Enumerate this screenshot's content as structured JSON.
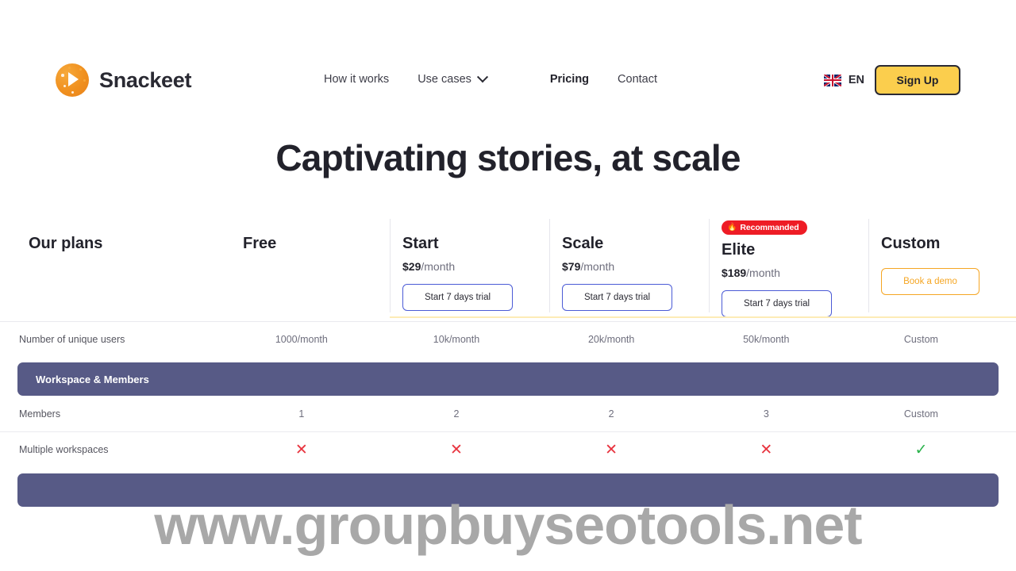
{
  "header": {
    "brand_name": "Snackeet",
    "nav": [
      {
        "label": "How it works",
        "active": false
      },
      {
        "label": "Use cases",
        "active": false,
        "has_dropdown": true
      },
      {
        "label": "Pricing",
        "active": true
      },
      {
        "label": "Contact",
        "active": false
      }
    ],
    "language": "EN",
    "signup_label": "Sign Up"
  },
  "hero": {
    "title": "Captivating stories, at scale"
  },
  "plans": {
    "label_header": "Our plans",
    "columns": [
      {
        "name": "Free",
        "price_amount": "",
        "price_period": "",
        "cta": "",
        "badge": ""
      },
      {
        "name": "Start",
        "price_amount": "$29",
        "price_period": "/month",
        "cta": "Start 7 days trial",
        "badge": ""
      },
      {
        "name": "Scale",
        "price_amount": "$79",
        "price_period": "/month",
        "cta": "Start 7 days trial",
        "badge": ""
      },
      {
        "name": "Elite",
        "price_amount": "$189",
        "price_period": "/month",
        "cta": "Start 7 days trial",
        "badge": "Recommanded"
      },
      {
        "name": "Custom",
        "price_amount": "",
        "price_period": "",
        "cta": "Book a demo",
        "badge": ""
      }
    ]
  },
  "features": {
    "unique_users": {
      "label": "Number of unique users",
      "values": [
        "1000/month",
        "10k/month",
        "20k/month",
        "50k/month",
        "Custom"
      ]
    },
    "section_workspace": "Workspace & Members",
    "members": {
      "label": "Members",
      "values": [
        "1",
        "2",
        "2",
        "3",
        "Custom"
      ]
    },
    "multiple_workspaces": {
      "label": "Multiple workspaces",
      "values": [
        "✕",
        "✕",
        "✕",
        "✕",
        "✓"
      ]
    },
    "section_next": ""
  },
  "watermark": "www.groupbuyseotools.net",
  "colors": {
    "accent_yellow": "#FBCE4D",
    "accent_orange": "#F5A623",
    "blue_outline": "#4B5BD6",
    "badge_red": "#EE1C25",
    "section_purple": "#575A86",
    "check_green": "#29B24A",
    "cross_red": "#E8343F"
  }
}
